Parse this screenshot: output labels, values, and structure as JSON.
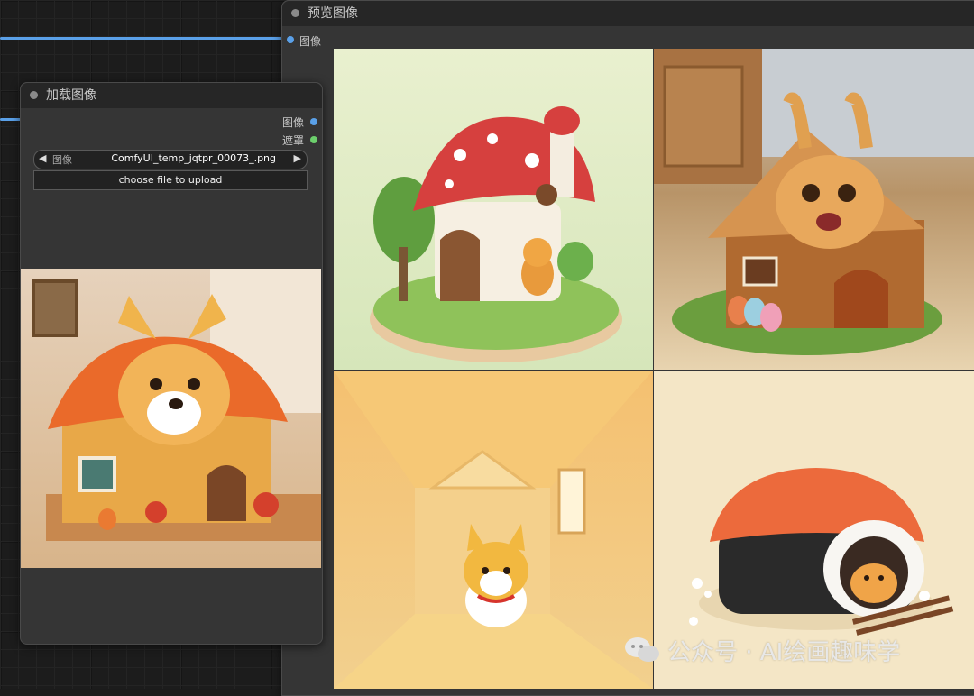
{
  "preview_node": {
    "title": "预览图像",
    "input_label": "图像"
  },
  "load_node": {
    "title": "加载图像",
    "outputs": [
      {
        "label": "图像",
        "color": "#5aa0e8"
      },
      {
        "label": "遮罩",
        "color": "#6ccf6c"
      }
    ],
    "widget_label": "图像",
    "widget_value": "ComfyUI_temp_jqtpr_00073_.png",
    "upload_button": "choose file to upload"
  },
  "watermark": "公众号 · AI绘画趣味学",
  "colors": {
    "link": "#5aa0e8",
    "node_bg": "#353535",
    "title_bg": "#262626"
  }
}
